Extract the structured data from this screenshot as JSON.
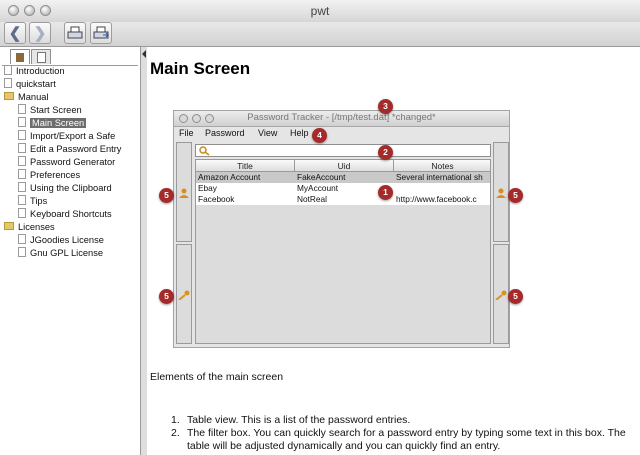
{
  "window": {
    "title": "pwt"
  },
  "toolbar": {
    "buttons": [
      {
        "name": "back-button",
        "icon": "chevron-left-icon"
      },
      {
        "name": "forward-button",
        "icon": "chevron-right-icon"
      },
      {
        "name": "print-button",
        "icon": "printer-icon"
      },
      {
        "name": "print-preview-button",
        "icon": "print-export-icon"
      }
    ]
  },
  "sidebar": {
    "items": [
      {
        "label": "Introduction",
        "level": 0,
        "kind": "page"
      },
      {
        "label": "quickstart",
        "level": 0,
        "kind": "page"
      },
      {
        "label": "Manual",
        "level": 0,
        "kind": "folder"
      },
      {
        "label": "Start Screen",
        "level": 1,
        "kind": "page"
      },
      {
        "label": "Main Screen",
        "level": 1,
        "kind": "page",
        "selected": true
      },
      {
        "label": "Import/Export a Safe",
        "level": 1,
        "kind": "page"
      },
      {
        "label": "Edit a Password Entry",
        "level": 1,
        "kind": "page"
      },
      {
        "label": "Password Generator",
        "level": 1,
        "kind": "page"
      },
      {
        "label": "Preferences",
        "level": 1,
        "kind": "page"
      },
      {
        "label": "Using the Clipboard",
        "level": 1,
        "kind": "page"
      },
      {
        "label": "Tips",
        "level": 1,
        "kind": "page"
      },
      {
        "label": "Keyboard Shortcuts",
        "level": 1,
        "kind": "page"
      },
      {
        "label": "Licenses",
        "level": 0,
        "kind": "folder"
      },
      {
        "label": "JGoodies License",
        "level": 1,
        "kind": "page"
      },
      {
        "label": "Gnu GPL License",
        "level": 1,
        "kind": "page"
      }
    ]
  },
  "content": {
    "heading": "Main Screen",
    "screenshot": {
      "window_title": "Password Tracker - [/tmp/test.dat] *changed*",
      "menu": [
        "File",
        "Password",
        "View",
        "Help"
      ],
      "columns": [
        "Title",
        "Uid",
        "Notes"
      ],
      "rows": [
        {
          "title": "Amazon Account",
          "uid": "FakeAccount",
          "notes": "Several international sh"
        },
        {
          "title": "Ebay",
          "uid": "MyAccount",
          "notes": ""
        },
        {
          "title": "Facebook",
          "uid": "NotReal",
          "notes": "http://www.facebook.c"
        }
      ],
      "callouts": [
        "1",
        "2",
        "3",
        "4",
        "5",
        "5",
        "5",
        "5"
      ],
      "callout_color": "#a52a2a"
    },
    "caption": "Elements of the main screen",
    "list": [
      {
        "num": "1.",
        "text": "Table view. This is a list of the password entries."
      },
      {
        "num": "2.",
        "text": "The filter box. You can quickly search for a password entry by typing some text in this box. The table will be adjusted dynamically and you can quickly find an entry."
      }
    ]
  }
}
